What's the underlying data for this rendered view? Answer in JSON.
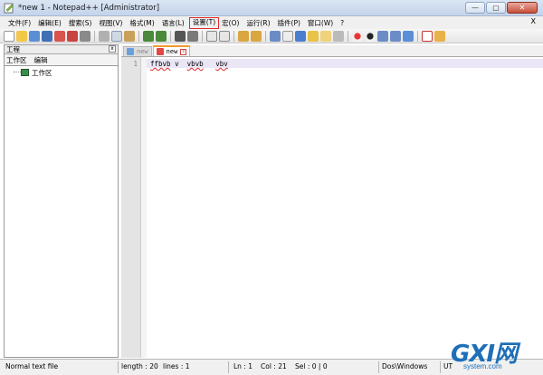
{
  "window": {
    "title": "*new  1 - Notepad++ [Administrator]",
    "controls": [
      "—",
      "▢",
      "✕"
    ]
  },
  "menubar": {
    "items": [
      "文件(F)",
      "编辑(E)",
      "搜索(S)",
      "视图(V)",
      "格式(M)",
      "语言(L)",
      "设置(T)",
      "宏(O)",
      "运行(R)",
      "插件(P)",
      "窗口(W)",
      "?"
    ],
    "highlighted_index": 6,
    "close_label": "X"
  },
  "panel": {
    "title": "工程",
    "close_label": "x",
    "menu": [
      "工作区",
      "编辑"
    ],
    "tree_item": "工作区"
  },
  "tabs": [
    {
      "label": "new",
      "active": false,
      "icon_color": "#6aa0dc"
    },
    {
      "label": "new",
      "active": true,
      "icon_color": "#e04848"
    }
  ],
  "tab_close_label": "x",
  "editor": {
    "line_number": "1",
    "code": [
      "ffbvb",
      "v",
      "vbvb",
      "vbv"
    ]
  },
  "statusbar": {
    "file_type": "Normal text file",
    "length": "length : 20",
    "lines": "lines : 1",
    "ln": "Ln : 1",
    "col": "Col : 21",
    "sel": "Sel : 0 | 0",
    "eol": "Dos\\Windows",
    "encoding": "UT"
  },
  "watermark": {
    "logo_text": "GXI网",
    "site": "system.com"
  },
  "colors": {
    "highlight_box": "#e02b2b",
    "current_line": "#eae6f6",
    "active_tab_accent": "#f29a2e"
  }
}
